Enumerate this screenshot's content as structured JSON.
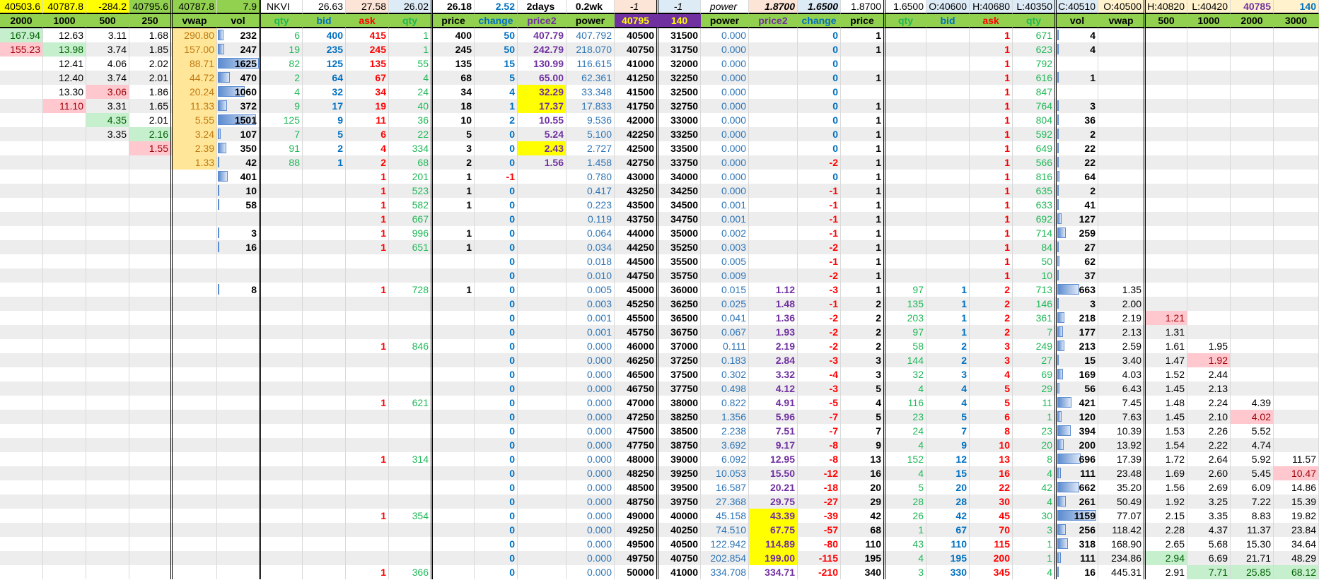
{
  "top_row": [
    "40503.6",
    "40787.8",
    "-284.2",
    "40795.6",
    "40787.8",
    "7.9",
    "NKVI",
    "26.63",
    "27.58",
    "26.02",
    "26.18",
    "2.52",
    "2days",
    "0.2wk",
    "-1",
    "-1",
    "power",
    "1.8700",
    "1.6500",
    "1.8700",
    "1.6500",
    "O:40600",
    "H:40680",
    "L:40350",
    "C:40510",
    "O:40500",
    "H:40820",
    "L:40420",
    "40785",
    "140"
  ],
  "headers": [
    "2000",
    "1000",
    "500",
    "250",
    "vwap",
    "vol",
    "qty",
    "bid",
    "ask",
    "qty",
    "price",
    "change",
    "price2",
    "power",
    "40795",
    "140",
    "power",
    "price2",
    "change",
    "price",
    "qty",
    "bid",
    "ask",
    "qty",
    "vol",
    "vwap",
    "500",
    "1000",
    "2000",
    "3000"
  ],
  "table": {
    "columns": [
      [
        "167.94",
        "155.23"
      ],
      [
        "12.63",
        "13.98",
        "12.41",
        "12.40",
        "13.30",
        "11.10"
      ],
      [
        "3.11",
        "3.74",
        "4.06",
        "3.74",
        "3.06",
        "3.31",
        "4.35",
        "3.35"
      ],
      [
        "1.68",
        "1.85",
        "2.02",
        "2.01",
        "1.86",
        "1.65",
        "2.01",
        "2.16",
        "1.55"
      ],
      [
        "290.80",
        "157.00",
        "88.71",
        "44.72",
        "20.24",
        "11.33",
        "5.55",
        "3.24",
        "2.39",
        "1.33"
      ],
      [
        "232",
        "247",
        "1625",
        "470",
        "1060",
        "372",
        "1501",
        "107",
        "350",
        "42",
        "401",
        "10",
        "58",
        "",
        "3",
        "16",
        "",
        "",
        "8"
      ],
      [
        "6",
        "19",
        "82",
        "2",
        "4",
        "9",
        "125",
        "7",
        "91",
        "88"
      ],
      [
        "400",
        "235",
        "125",
        "64",
        "32",
        "17",
        "9",
        "5",
        "2",
        "1"
      ],
      [
        "415",
        "245",
        "135",
        "67",
        "34",
        "19",
        "11",
        "6",
        "4",
        "2",
        "1",
        "1",
        "1",
        "1",
        "1",
        "1",
        "",
        "",
        "1",
        "",
        "",
        "",
        "1",
        "",
        "",
        "",
        "1",
        "",
        "",
        "",
        "1",
        "",
        "",
        "",
        "1",
        "",
        "",
        "",
        "1"
      ],
      [
        "1",
        "1",
        "55",
        "4",
        "24",
        "40",
        "36",
        "22",
        "334",
        "68",
        "201",
        "523",
        "582",
        "667",
        "996",
        "651",
        "",
        "",
        "728",
        "",
        "",
        "",
        "846",
        "",
        "",
        "",
        "621",
        "",
        "",
        "",
        "314",
        "",
        "",
        "",
        "354",
        "",
        "",
        "",
        "366"
      ],
      [
        "400",
        "245",
        "135",
        "68",
        "34",
        "18",
        "10",
        "5",
        "3",
        "2",
        "1",
        "1",
        "1",
        "",
        "1",
        "1",
        "",
        "",
        "1"
      ],
      [
        "50",
        "50",
        "15",
        "5",
        "4",
        "1",
        "2",
        "0",
        "0",
        "0",
        "-1",
        "0",
        "0",
        "0",
        "0",
        "0",
        "0",
        "0",
        "0",
        "0",
        "0",
        "0",
        "0",
        "0",
        "0",
        "0",
        "0",
        "0",
        "0",
        "0",
        "0",
        "0",
        "0",
        "0",
        "0",
        "0",
        "0",
        "0",
        "0"
      ],
      [
        "407.79",
        "242.79",
        "130.99",
        "65.00",
        "32.29",
        "17.37",
        "10.55",
        "5.24",
        "2.43",
        "1.56"
      ],
      [
        "407.792",
        "218.070",
        "116.615",
        "62.361",
        "33.348",
        "17.833",
        "9.536",
        "5.100",
        "2.727",
        "1.458",
        "0.780",
        "0.417",
        "0.223",
        "0.119",
        "0.064",
        "0.034",
        "0.018",
        "0.010",
        "0.005",
        "0.003",
        "0.001",
        "0.001",
        "0.000",
        "0.000",
        "0.000",
        "0.000",
        "0.000",
        "0.000",
        "0.000",
        "0.000",
        "0.000",
        "0.000",
        "0.000",
        "0.000",
        "0.000",
        "0.000",
        "0.000",
        "0.000",
        "0.000"
      ],
      [
        "40500",
        "40750",
        "41000",
        "41250",
        "41500",
        "41750",
        "42000",
        "42250",
        "42500",
        "42750",
        "43000",
        "43250",
        "43500",
        "43750",
        "44000",
        "44250",
        "44500",
        "44750",
        "45000",
        "45250",
        "45500",
        "45750",
        "46000",
        "46250",
        "46500",
        "46750",
        "47000",
        "47250",
        "47500",
        "47750",
        "48000",
        "48250",
        "48500",
        "48750",
        "49000",
        "49250",
        "49500",
        "49750",
        "50000"
      ],
      [
        "31500",
        "31750",
        "32000",
        "32250",
        "32500",
        "32750",
        "33000",
        "33250",
        "33500",
        "33750",
        "34000",
        "34250",
        "34500",
        "34750",
        "35000",
        "35250",
        "35500",
        "35750",
        "36000",
        "36250",
        "36500",
        "36750",
        "37000",
        "37250",
        "37500",
        "37750",
        "38000",
        "38250",
        "38500",
        "38750",
        "39000",
        "39250",
        "39500",
        "39750",
        "40000",
        "40250",
        "40500",
        "40750",
        "41000"
      ],
      [
        "0.000",
        "0.000",
        "0.000",
        "0.000",
        "0.000",
        "0.000",
        "0.000",
        "0.000",
        "0.000",
        "0.000",
        "0.000",
        "0.000",
        "0.001",
        "0.001",
        "0.002",
        "0.003",
        "0.005",
        "0.009",
        "0.015",
        "0.025",
        "0.041",
        "0.067",
        "0.111",
        "0.183",
        "0.302",
        "0.498",
        "0.822",
        "1.356",
        "2.238",
        "3.692",
        "6.092",
        "10.053",
        "16.587",
        "27.368",
        "45.158",
        "74.510",
        "122.942",
        "202.854",
        "334.708"
      ],
      [
        "",
        "",
        "",
        "",
        "",
        "",
        "",
        "",
        "",
        "",
        "",
        "",
        "",
        "",
        "",
        "",
        "",
        "",
        "1.12",
        "1.48",
        "1.36",
        "1.93",
        "2.19",
        "2.84",
        "3.32",
        "4.12",
        "4.91",
        "5.96",
        "7.51",
        "9.17",
        "12.95",
        "15.50",
        "20.21",
        "29.75",
        "43.39",
        "67.75",
        "114.89",
        "199.00",
        "334.71"
      ],
      [
        "0",
        "0",
        "0",
        "0",
        "0",
        "0",
        "0",
        "0",
        "0",
        "-2",
        "0",
        "-1",
        "-1",
        "-1",
        "-1",
        "-2",
        "-1",
        "-2",
        "-3",
        "-1",
        "-2",
        "-2",
        "-2",
        "-3",
        "-4",
        "-3",
        "-5",
        "-7",
        "-7",
        "-8",
        "-8",
        "-12",
        "-18",
        "-27",
        "-39",
        "-57",
        "-80",
        "-115",
        "-210"
      ],
      [
        "1",
        "1",
        "",
        "1",
        "",
        "1",
        "1",
        "1",
        "1",
        "1",
        "1",
        "1",
        "1",
        "1",
        "1",
        "1",
        "1",
        "1",
        "1",
        "2",
        "2",
        "2",
        "2",
        "3",
        "3",
        "5",
        "4",
        "5",
        "7",
        "9",
        "13",
        "16",
        "20",
        "29",
        "42",
        "68",
        "110",
        "195",
        "340"
      ],
      [
        "",
        "",
        "",
        "",
        "",
        "",
        "",
        "",
        "",
        "",
        "",
        "",
        "",
        "",
        "",
        "",
        "",
        "",
        "97",
        "135",
        "203",
        "97",
        "58",
        "144",
        "32",
        "4",
        "116",
        "23",
        "24",
        "4",
        "152",
        "4",
        "5",
        "28",
        "26",
        "1",
        "43",
        "4",
        "3"
      ],
      [
        "",
        "",
        "",
        "",
        "",
        "",
        "",
        "",
        "",
        "",
        "",
        "",
        "",
        "",
        "",
        "",
        "",
        "",
        "1",
        "1",
        "1",
        "1",
        "2",
        "2",
        "3",
        "4",
        "4",
        "5",
        "7",
        "9",
        "12",
        "15",
        "20",
        "28",
        "42",
        "67",
        "110",
        "195",
        "330"
      ],
      [
        "1",
        "1",
        "1",
        "1",
        "1",
        "1",
        "1",
        "1",
        "1",
        "1",
        "1",
        "1",
        "1",
        "1",
        "1",
        "1",
        "1",
        "1",
        "2",
        "2",
        "2",
        "2",
        "3",
        "3",
        "4",
        "5",
        "5",
        "6",
        "8",
        "10",
        "13",
        "16",
        "22",
        "30",
        "45",
        "70",
        "115",
        "200",
        "345"
      ],
      [
        "671",
        "623",
        "792",
        "616",
        "847",
        "764",
        "804",
        "592",
        "649",
        "566",
        "816",
        "635",
        "633",
        "692",
        "714",
        "84",
        "50",
        "10",
        "713",
        "146",
        "361",
        "7",
        "249",
        "27",
        "69",
        "29",
        "11",
        "1",
        "23",
        "20",
        "8",
        "4",
        "42",
        "4",
        "30",
        "3",
        "1",
        "1",
        "4"
      ],
      [
        "4",
        "4",
        "",
        "1",
        "",
        "3",
        "36",
        "2",
        "22",
        "22",
        "64",
        "2",
        "41",
        "127",
        "259",
        "27",
        "62",
        "37",
        "663",
        "3",
        "218",
        "177",
        "213",
        "15",
        "169",
        "56",
        "421",
        "120",
        "394",
        "200",
        "696",
        "111",
        "662",
        "261",
        "1159",
        "256",
        "318",
        "111",
        "16"
      ],
      [
        "",
        "",
        "",
        "",
        "",
        "",
        "",
        "",
        "",
        "",
        "",
        "",
        "",
        "",
        "",
        "",
        "",
        "",
        "1.35",
        "2.00",
        "2.19",
        "2.13",
        "2.59",
        "3.40",
        "4.03",
        "6.43",
        "7.45",
        "7.63",
        "10.39",
        "13.92",
        "17.39",
        "23.48",
        "35.20",
        "50.49",
        "77.07",
        "118.42",
        "168.90",
        "234.86",
        "445.31"
      ],
      [
        "",
        "",
        "",
        "",
        "",
        "",
        "",
        "",
        "",
        "",
        "",
        "",
        "",
        "",
        "",
        "",
        "",
        "",
        "",
        "",
        "1.21",
        "1.31",
        "1.61",
        "1.47",
        "1.52",
        "1.45",
        "1.48",
        "1.45",
        "1.53",
        "1.54",
        "1.72",
        "1.69",
        "1.56",
        "1.92",
        "2.15",
        "2.28",
        "2.65",
        "2.94",
        "2.91"
      ],
      [
        "",
        "",
        "",
        "",
        "",
        "",
        "",
        "",
        "",
        "",
        "",
        "",
        "",
        "",
        "",
        "",
        "",
        "",
        "",
        "",
        "",
        "",
        "1.95",
        "1.92",
        "2.44",
        "2.13",
        "2.24",
        "2.10",
        "2.26",
        "2.22",
        "2.64",
        "2.60",
        "2.69",
        "3.25",
        "3.35",
        "4.37",
        "5.68",
        "6.69",
        "7.71"
      ],
      [
        "",
        "",
        "",
        "",
        "",
        "",
        "",
        "",
        "",
        "",
        "",
        "",
        "",
        "",
        "",
        "",
        "",
        "",
        "",
        "",
        "",
        "",
        "",
        "",
        "",
        "",
        "4.39",
        "4.02",
        "5.52",
        "4.74",
        "5.92",
        "5.45",
        "6.09",
        "7.22",
        "8.83",
        "11.37",
        "15.30",
        "21.71",
        "25.85"
      ],
      [
        "",
        "",
        "",
        "",
        "",
        "",
        "",
        "",
        "",
        "",
        "",
        "",
        "",
        "",
        "",
        "",
        "",
        "",
        "",
        "",
        "",
        "",
        "",
        "",
        "",
        "",
        "",
        "",
        "",
        "",
        "11.57",
        "10.47",
        "14.86",
        "15.39",
        "19.82",
        "23.84",
        "34.64",
        "48.29",
        "68.12"
      ]
    ],
    "highlights": [
      {
        "col": 0,
        "row": 0,
        "type": "good"
      },
      {
        "col": 0,
        "row": 1,
        "type": "bad"
      },
      {
        "col": 1,
        "row": 1,
        "type": "good"
      },
      {
        "col": 2,
        "row": 4,
        "type": "bad"
      },
      {
        "col": 1,
        "row": 5,
        "type": "bad"
      },
      {
        "col": 2,
        "row": 6,
        "type": "good"
      },
      {
        "col": 3,
        "row": 7,
        "type": "good"
      },
      {
        "col": 3,
        "row": 8,
        "type": "bad"
      },
      {
        "col": 12,
        "row": 4,
        "type": "mark"
      },
      {
        "col": 12,
        "row": 5,
        "type": "mark"
      },
      {
        "col": 12,
        "row": 8,
        "type": "mark"
      },
      {
        "col": 17,
        "row": 34,
        "type": "mark"
      },
      {
        "col": 17,
        "row": 35,
        "type": "mark"
      },
      {
        "col": 17,
        "row": 36,
        "type": "mark"
      },
      {
        "col": 17,
        "row": 37,
        "type": "mark"
      },
      {
        "col": 26,
        "row": 20,
        "type": "bad"
      },
      {
        "col": 26,
        "row": 37,
        "type": "good"
      },
      {
        "col": 27,
        "row": 23,
        "type": "bad"
      },
      {
        "col": 27,
        "row": 38,
        "type": "good"
      },
      {
        "col": 28,
        "row": 27,
        "type": "bad"
      },
      {
        "col": 28,
        "row": 38,
        "type": "good"
      },
      {
        "col": 29,
        "row": 31,
        "type": "bad"
      },
      {
        "col": 29,
        "row": 38,
        "type": "good"
      }
    ]
  }
}
